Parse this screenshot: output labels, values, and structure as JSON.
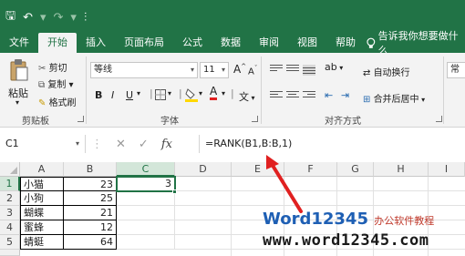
{
  "qat": {
    "save": "🖫",
    "undo": "↶",
    "redo": "↷",
    "customize": "⫶"
  },
  "tabs": [
    "文件",
    "开始",
    "插入",
    "页面布局",
    "公式",
    "数据",
    "审阅",
    "视图",
    "帮助"
  ],
  "active_tab": "开始",
  "tell_me": "告诉我你想要做什么",
  "clipboard": {
    "paste": "粘贴",
    "cut": "剪切",
    "copy": "复制",
    "format_painter": "格式刷",
    "group": "剪贴板"
  },
  "font": {
    "name": "等线",
    "size": "11",
    "grow": "A",
    "shrink": "A",
    "bold": "B",
    "italic": "I",
    "underline": "U",
    "group": "字体",
    "wen": "文"
  },
  "alignment": {
    "wrap": "自动换行",
    "merge": "合并后居中",
    "group": "对齐方式",
    "orient": "ab",
    "partial": "常"
  },
  "formula_bar": {
    "name_box": "C1",
    "cancel": "✕",
    "enter": "✓",
    "fx": "fx",
    "formula": "=RANK(B1,B:B,1)"
  },
  "columns": [
    "A",
    "B",
    "C",
    "D",
    "E",
    "F",
    "G",
    "H",
    "I"
  ],
  "rows": [
    {
      "num": "1",
      "a": "小猫",
      "b": "23",
      "c": "3"
    },
    {
      "num": "2",
      "a": "小狗",
      "b": "25",
      "c": ""
    },
    {
      "num": "3",
      "a": "蝴蝶",
      "b": "21",
      "c": ""
    },
    {
      "num": "4",
      "a": "蜜蜂",
      "b": "12",
      "c": ""
    },
    {
      "num": "5",
      "a": "蜻蜓",
      "b": "64",
      "c": ""
    }
  ],
  "watermark": {
    "brand": "Word12345",
    "slogan": "办公软件教程",
    "url": "www.word12345.com"
  },
  "colors": {
    "excel_green": "#217346",
    "arrow_red": "#e02020"
  }
}
